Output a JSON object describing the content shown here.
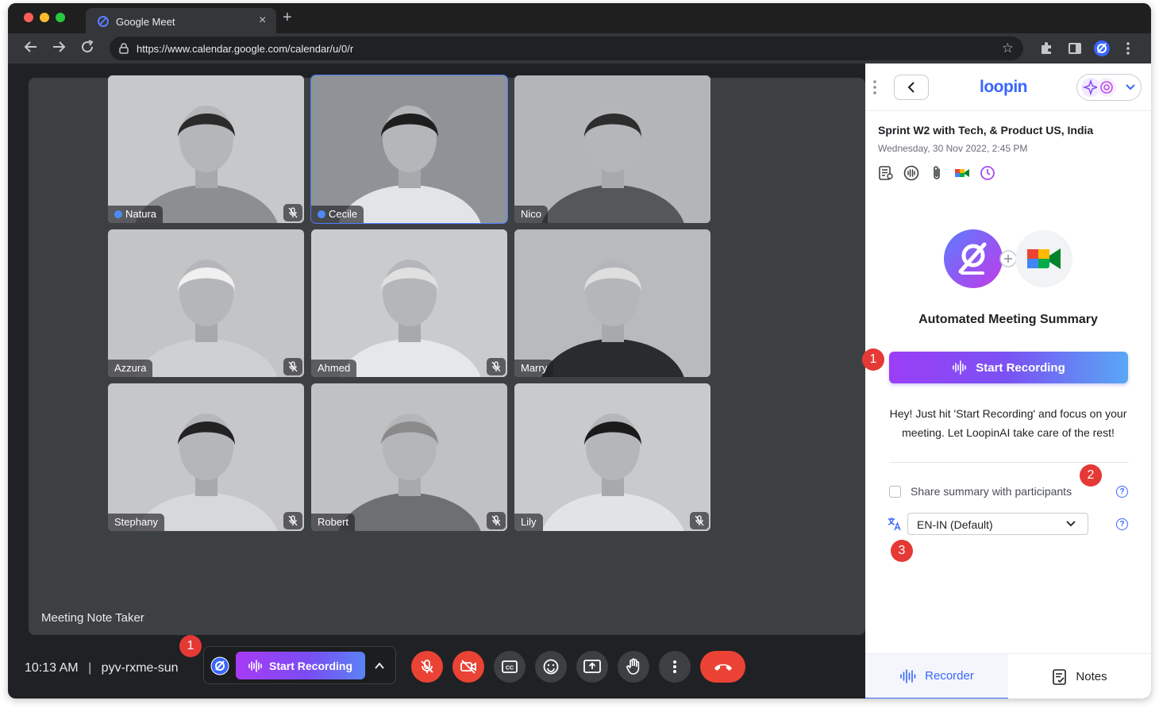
{
  "browser": {
    "tab_title": "Google Meet",
    "url": "https://www.calendar.google.com/calendar/u/0/r"
  },
  "meeting": {
    "participants": [
      {
        "name": "Natura",
        "verified": true,
        "muted": true
      },
      {
        "name": "Cecile",
        "verified": true,
        "muted": false,
        "active": true
      },
      {
        "name": "Nico",
        "verified": false,
        "muted": false
      },
      {
        "name": "Azzura",
        "verified": false,
        "muted": true
      },
      {
        "name": "Ahmed",
        "verified": false,
        "muted": true
      },
      {
        "name": "Marry",
        "verified": false,
        "muted": false
      },
      {
        "name": "Stephany",
        "verified": false,
        "muted": true
      },
      {
        "name": "Robert",
        "verified": false,
        "muted": true
      },
      {
        "name": "Lily",
        "verified": false,
        "muted": true
      }
    ],
    "label": "Meeting Note Taker",
    "time": "10:13 AM",
    "separator": "|",
    "code": "pyv-rxme-sun",
    "record_label": "Start Recording"
  },
  "badges": {
    "one": "1",
    "two": "2",
    "three": "3"
  },
  "panel": {
    "logo": "loopin",
    "title": "Sprint W2 with Tech, & Product US, India",
    "date": "Wednesday, 30 Nov 2022, 2:45 PM",
    "heading": "Automated Meeting Summary",
    "record_label": "Start Recording",
    "help_line1": "Hey! Just hit 'Start Recording' and focus on your",
    "help_line2": "meeting. Let LoopinAI take care of the rest!",
    "share_label": "Share summary with participants",
    "language": "EN-IN (Default)",
    "tabs": {
      "recorder": "Recorder",
      "notes": "Notes"
    }
  },
  "colors": {
    "accent": "#3966ff",
    "danger": "#ea4335",
    "gradient_start": "#a73bf5",
    "gradient_end": "#58a8f5"
  }
}
